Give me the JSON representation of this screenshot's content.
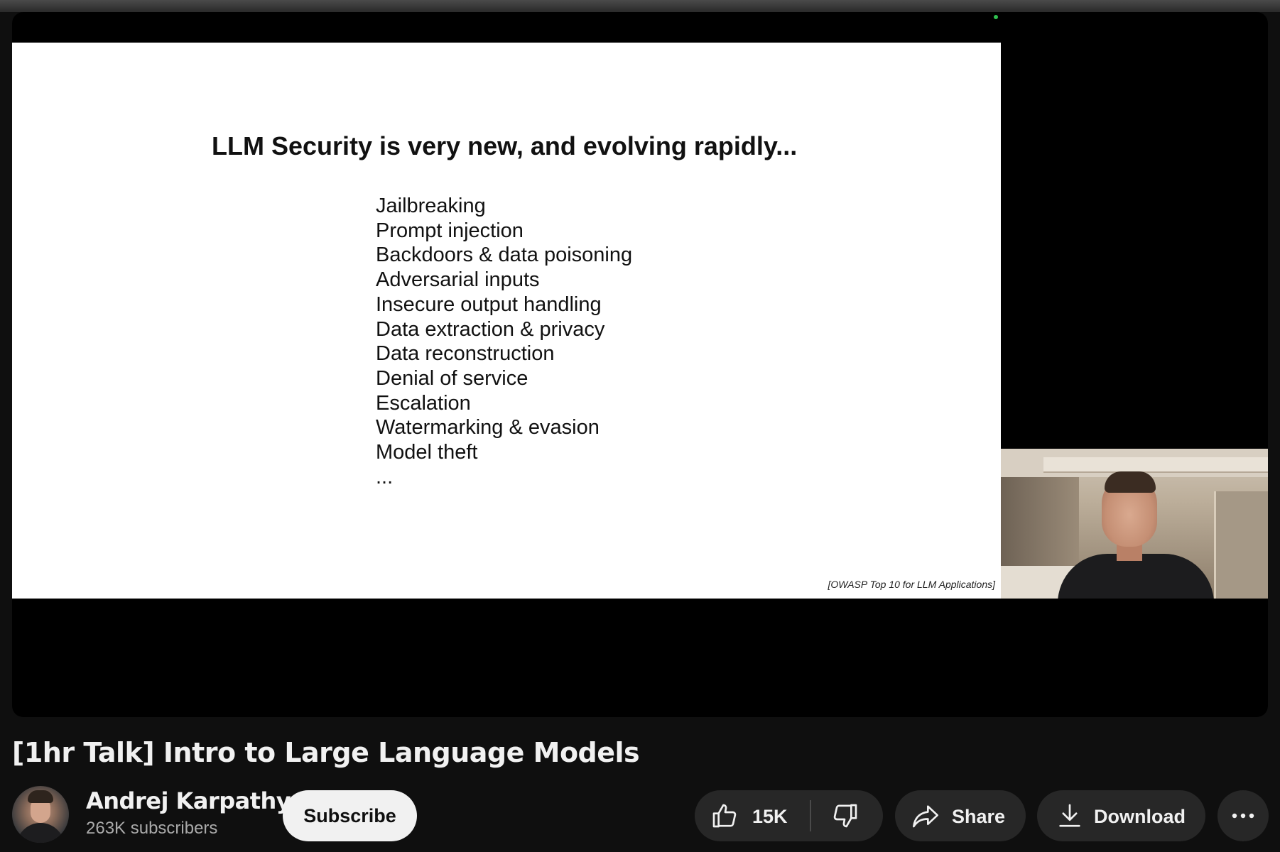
{
  "slide": {
    "title": "LLM Security is very new, and evolving rapidly...",
    "items": [
      "Jailbreaking",
      "Prompt injection",
      "Backdoors & data poisoning",
      "Adversarial inputs",
      "Insecure output handling",
      "Data extraction & privacy",
      "Data reconstruction",
      "Denial of service",
      "Escalation",
      "Watermarking & evasion",
      "Model theft",
      "..."
    ],
    "footnote": "[OWASP Top 10 for LLM Applications]"
  },
  "video": {
    "title": "[1hr Talk] Intro to Large Language Models"
  },
  "channel": {
    "name": "Andrej Karpathy",
    "subscribers": "263K subscribers",
    "subscribe_label": "Subscribe"
  },
  "actions": {
    "like_count": "15K",
    "share_label": "Share",
    "download_label": "Download"
  },
  "icons": {
    "like": "thumbs-up-icon",
    "dislike": "thumbs-down-icon",
    "share": "share-arrow-icon",
    "download": "download-icon",
    "more": "more-horizontal-icon"
  },
  "colors": {
    "page_background": "#0f0f0f",
    "pill_background": "#272727",
    "subscribe_background": "#f1f1f1",
    "text_primary": "#f1f1f1",
    "text_secondary": "#aaaaaa"
  }
}
